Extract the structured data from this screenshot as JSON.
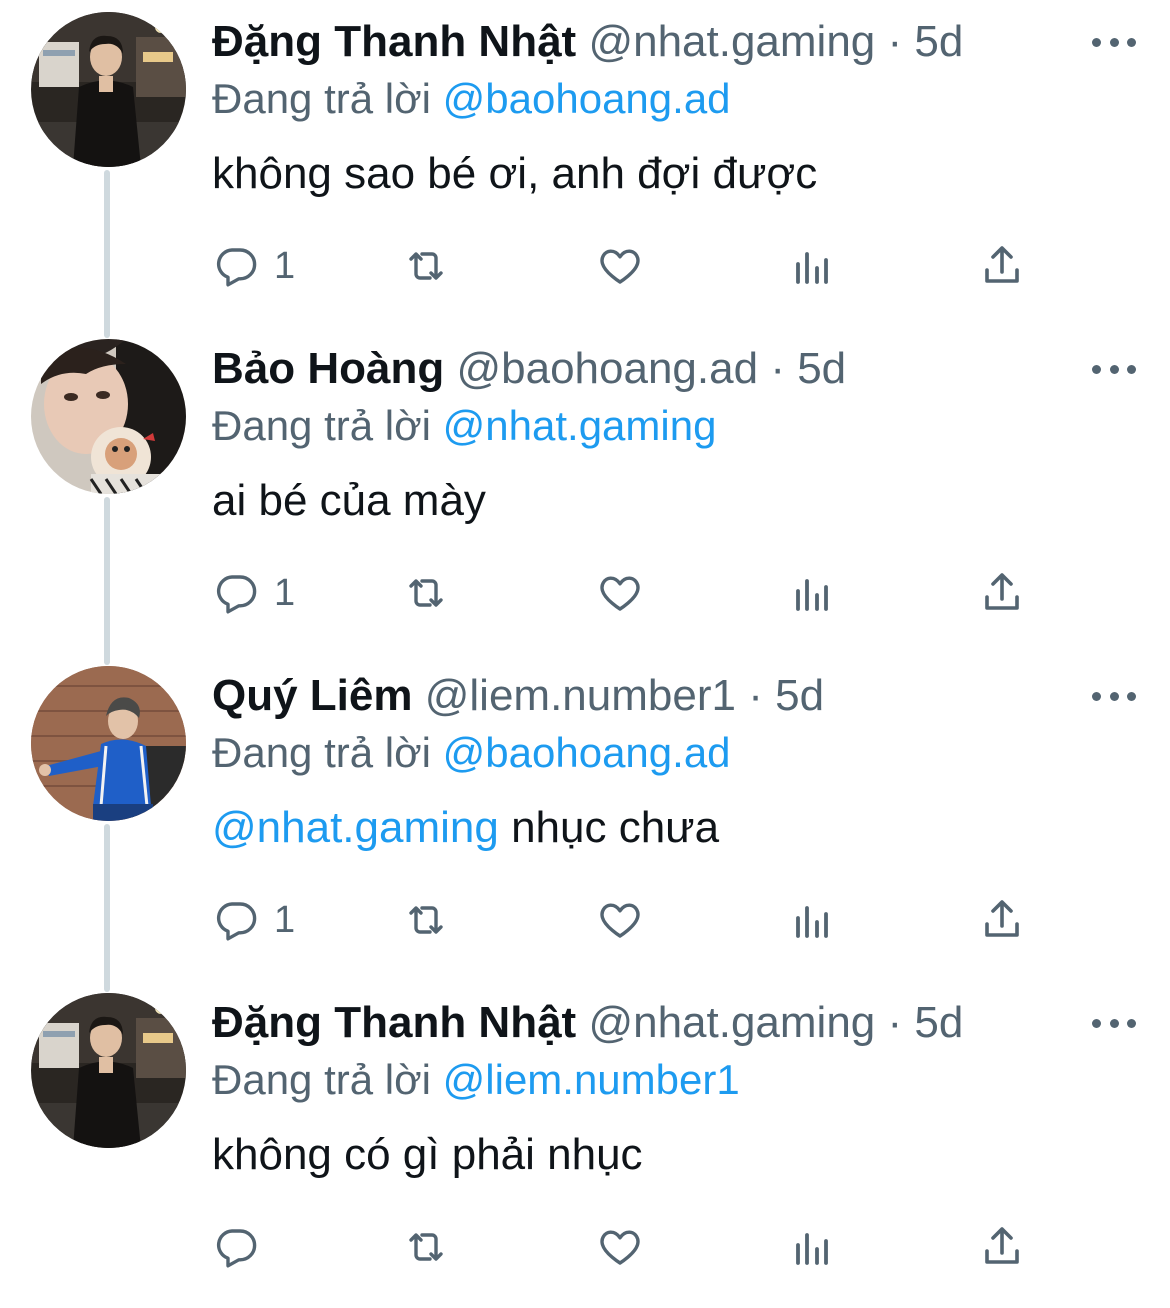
{
  "tweets": [
    {
      "name": "Đặng Thanh Nhật",
      "handle": "@nhat.gaming",
      "separator": "·",
      "time": "5d",
      "replying_prefix": "Đang trả lời",
      "replying_to": "@baohoang.ad",
      "mention": "",
      "text": "không sao bé ơi, anh đợi được",
      "reply_count": "1",
      "avatar": "avatar-photo-street-night"
    },
    {
      "name": "Bảo Hoàng",
      "handle": "@baohoang.ad",
      "separator": "·",
      "time": "5d",
      "replying_prefix": "Đang trả lời",
      "replying_to": "@nhat.gaming",
      "mention": "",
      "text": "ai bé của mày",
      "reply_count": "1",
      "avatar": "avatar-photo-selfie"
    },
    {
      "name": "Quý Liêm",
      "handle": "@liem.number1",
      "separator": "·",
      "time": "5d",
      "replying_prefix": "Đang trả lời",
      "replying_to": "@baohoang.ad",
      "mention": "@nhat.gaming",
      "text": " nhục chưa",
      "reply_count": "1",
      "avatar": "avatar-photo-blue-jacket"
    },
    {
      "name": "Đặng Thanh Nhật",
      "handle": "@nhat.gaming",
      "separator": "·",
      "time": "5d",
      "replying_prefix": "Đang trả lời",
      "replying_to": "@liem.number1",
      "mention": "",
      "text": "không có gì phải nhục",
      "reply_count": "",
      "avatar": "avatar-photo-street-night"
    }
  ],
  "icons": {
    "reply": "reply-icon",
    "retweet": "retweet-icon",
    "like": "heart-icon",
    "views": "views-chart-icon",
    "share": "share-icon",
    "more": "more-dots-icon"
  },
  "colors": {
    "name": "#0f1419",
    "muted": "#536471",
    "link": "#1d9bf0",
    "thread_line": "#cfd9de"
  }
}
